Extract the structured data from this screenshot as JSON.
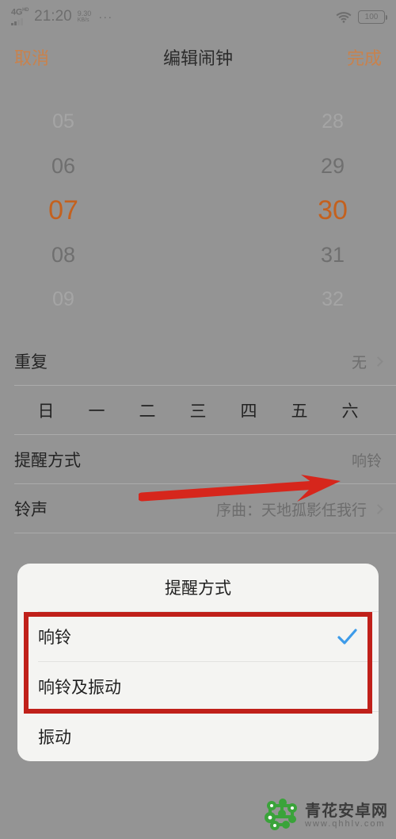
{
  "statusbar": {
    "network_type": "4G",
    "network_sup": "HD",
    "time": "21:20",
    "speed_value": "9.30",
    "speed_unit": "KB/s",
    "overflow": "···",
    "battery": "100",
    "wifi_icon": "wifi-icon"
  },
  "appbar": {
    "cancel": "取消",
    "title": "编辑闹钟",
    "done": "完成",
    "accent_color": "#c8824d"
  },
  "picker": {
    "hours": [
      "05",
      "06",
      "07",
      "08",
      "09"
    ],
    "minutes": [
      "28",
      "29",
      "30",
      "31",
      "32"
    ],
    "selected_hour": "07",
    "selected_minute": "30",
    "selected_color": "#c4611e"
  },
  "rows": {
    "repeat": {
      "label": "重复",
      "value": "无"
    },
    "days": [
      "日",
      "一",
      "二",
      "三",
      "四",
      "五",
      "六"
    ],
    "reminder": {
      "label": "提醒方式",
      "value": "响铃"
    },
    "ringtone": {
      "label": "铃声",
      "value": "序曲：天地孤影任我行"
    }
  },
  "dialog": {
    "title": "提醒方式",
    "options": [
      {
        "label": "响铃",
        "checked": true
      },
      {
        "label": "响铃及振动",
        "checked": false
      },
      {
        "label": "振动",
        "checked": false
      }
    ],
    "check_color": "#3d9be9",
    "background": "#f4f4f2"
  },
  "annotations": {
    "arrow_color": "#d6261c",
    "box_color": "#c0201a",
    "arrow_name": "red-arrow-annotation",
    "box_name": "red-highlight-box-annotation"
  },
  "watermark": {
    "site_name": "青花安卓网",
    "url": "www.qhhlv.com",
    "logo_color": "#3aa33a"
  }
}
